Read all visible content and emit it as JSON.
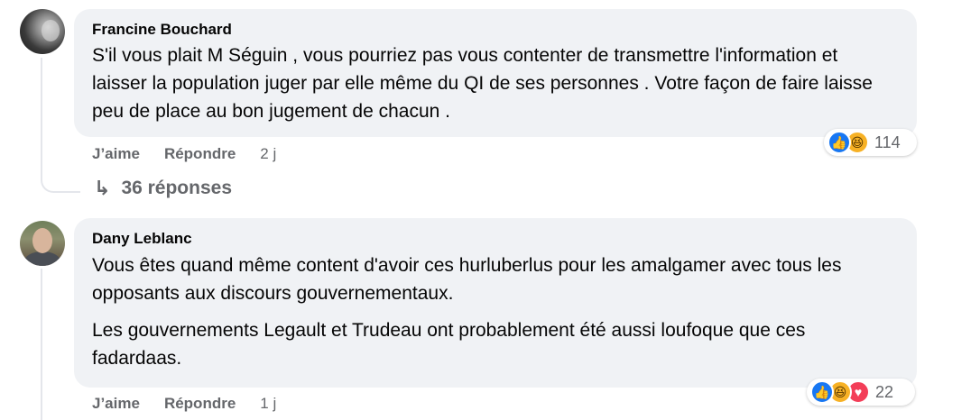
{
  "comments": [
    {
      "author": "Francine Bouchard",
      "paragraphs": [
        "S'il vous plait M Séguin , vous pourriez pas vous contenter de transmettre l'information et laisser la population juger par elle même du QI de ses personnes . Votre façon de faire laisse peu de place au bon jugement de chacun ."
      ],
      "like_label": "J’aime",
      "reply_label": "Répondre",
      "time": "2 j",
      "reactions": {
        "icons": [
          "like-icon",
          "haha-icon"
        ],
        "count": "114"
      },
      "replies_label": "36 réponses"
    },
    {
      "author": "Dany Leblanc",
      "paragraphs": [
        "Vous êtes quand même content d'avoir ces hurluberlus pour les amalgamer avec tous les opposants aux discours gouvernementaux.",
        "Les gouvernements Legault et Trudeau ont probablement été aussi loufoque que ces fadardaas."
      ],
      "like_label": "J’aime",
      "reply_label": "Répondre",
      "time": "1 j",
      "reactions": {
        "icons": [
          "like-icon",
          "haha-icon",
          "love-icon"
        ],
        "count": "22"
      }
    }
  ],
  "colors": {
    "bubble": "#f0f2f5",
    "secondary_text": "#65676b",
    "like": "#1877f2",
    "haha": "#f7b125",
    "love": "#f33e58"
  }
}
